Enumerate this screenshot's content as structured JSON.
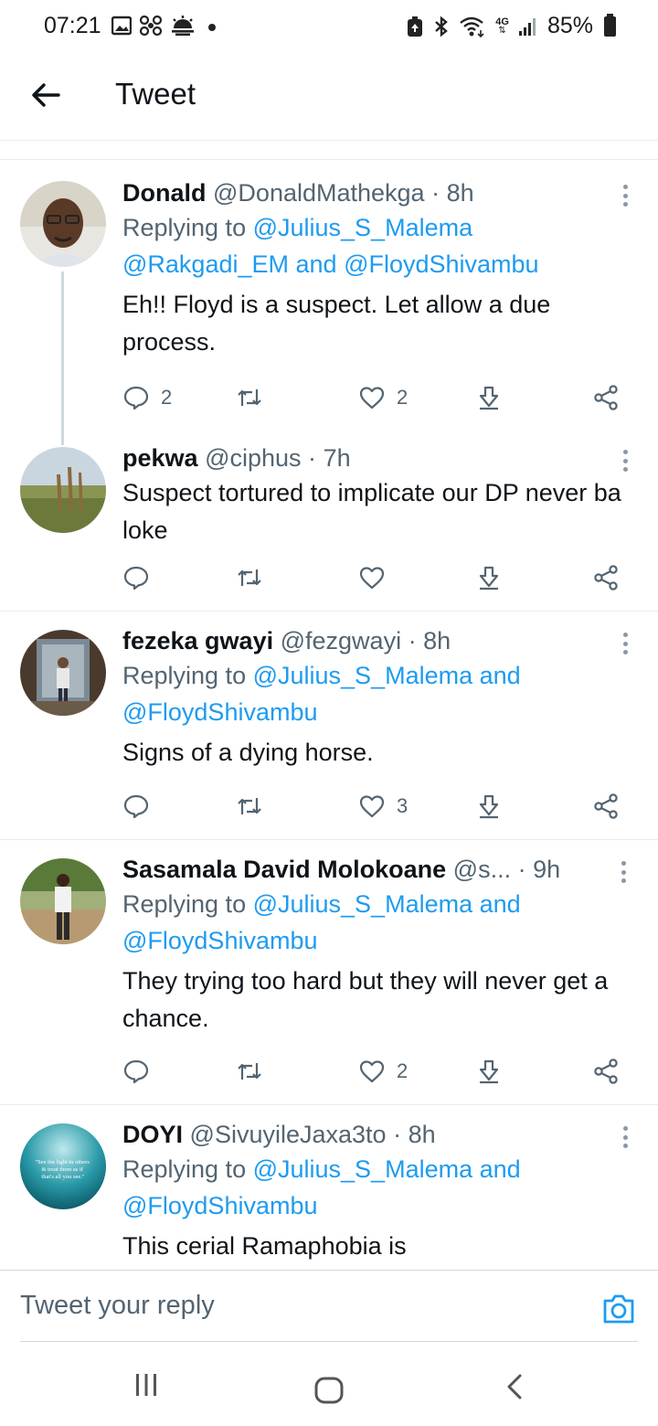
{
  "status_bar": {
    "time": "07:21",
    "network": "4G",
    "battery": "85%",
    "left_icons": [
      "gallery-icon",
      "fan-icon",
      "weather-icon",
      "dot-icon"
    ],
    "right_icons": [
      "battery-saver-icon",
      "bluetooth-icon",
      "wifi-icon",
      "signal-icon",
      "battery-icon"
    ]
  },
  "header": {
    "title": "Tweet",
    "back_icon": "arrow-left-icon"
  },
  "colors": {
    "link": "#1d9bf0",
    "secondary_text": "#536471",
    "primary_text": "#0f1419",
    "divider": "#e6ecf0"
  },
  "tweets": [
    {
      "name": "Donald",
      "handle": "@DonaldMathekga",
      "time": "8h",
      "replying_prefix": "Replying to ",
      "reply_line1_mention": "@Julius_S_Malema",
      "reply_line2_mention1": "@Rakgadi_EM",
      "reply_and": " and ",
      "reply_line2_mention2": "@FloydShivambu",
      "text": "Eh!! Floyd is a suspect. Let allow a due process.",
      "replies": "2",
      "retweets": "",
      "likes": "2"
    },
    {
      "name": "pekwa",
      "handle": "@ciphus",
      "time": "7h",
      "text": "Suspect tortured to implicate our DP never ba loke",
      "replies": "",
      "retweets": "",
      "likes": ""
    },
    {
      "name": "fezeka gwayi",
      "handle": "@fezgwayi",
      "time": "8h",
      "replying_prefix": "Replying to ",
      "reply_mention1": "@Julius_S_Malema",
      "reply_and": " and",
      "reply_mention2": "@FloydShivambu",
      "text": "Signs of a dying horse.",
      "replies": "",
      "retweets": "",
      "likes": "3"
    },
    {
      "name": "Sasamala David Molokoane",
      "handle": "@s...",
      "time": "9h",
      "replying_prefix": "Replying to ",
      "reply_mention1": "@Julius_S_Malema",
      "reply_and": " and",
      "reply_mention2": "@FloydShivambu",
      "text": "They trying too hard but they will never get a chance.",
      "replies": "",
      "retweets": "",
      "likes": "2"
    },
    {
      "name": "DOYI",
      "handle": "@SivuyileJaxa3to",
      "time": "8h",
      "replying_prefix": "Replying to ",
      "reply_mention1": "@Julius_S_Malema",
      "reply_and": " and",
      "reply_mention2": "@FloydShivambu",
      "text": "This cerial Ramaphobia is",
      "avatar_text": "\"See the light in others & treat them as if that's all you see.\""
    }
  ],
  "reply_bar": {
    "placeholder": "Tweet your reply",
    "camera_icon": "camera-icon"
  },
  "nav_bar": {
    "icons": [
      "recents-icon",
      "home-icon",
      "back-icon"
    ]
  }
}
